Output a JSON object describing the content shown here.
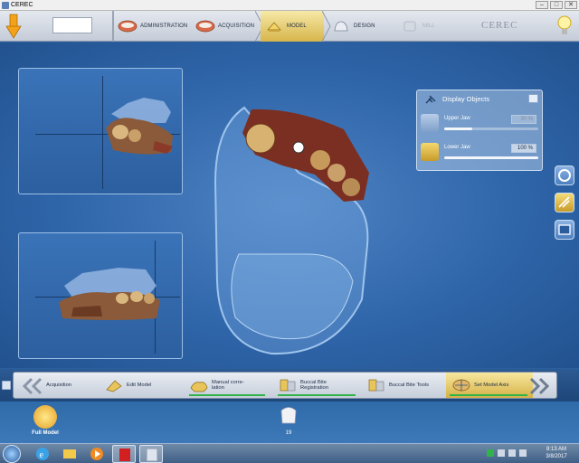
{
  "window": {
    "title": "CEREC",
    "controls": [
      "–",
      "□",
      "✕"
    ]
  },
  "topnav": {
    "steps": [
      {
        "label": "ADMINISTRATION",
        "icon": "administration-icon",
        "state": "normal"
      },
      {
        "label": "ACQUISITION",
        "icon": "acquisition-icon",
        "state": "normal"
      },
      {
        "label": "MODEL",
        "icon": "model-icon",
        "state": "active"
      },
      {
        "label": "DESIGN",
        "icon": "design-icon",
        "state": "normal"
      },
      {
        "label": "MILL",
        "icon": "mill-icon",
        "state": "disabled"
      }
    ],
    "logo": "CEREC"
  },
  "display_objects": {
    "title": "Display Objects",
    "rows": [
      {
        "label": "Upper Jaw",
        "value": "30 %",
        "level": 0.3,
        "icon": "upper-jaw-icon"
      },
      {
        "label": "Lower Jaw",
        "value": "100 %",
        "level": 1.0,
        "icon": "lower-jaw-icon"
      }
    ]
  },
  "side_buttons": [
    {
      "icon": "rotate-view-icon",
      "active": false
    },
    {
      "icon": "measure-tool-icon",
      "active": true
    },
    {
      "icon": "screenshot-icon",
      "active": false
    }
  ],
  "workflow": {
    "steps": [
      {
        "label": "Acquisition",
        "icon": "back-chevron-icon",
        "done": false,
        "active": false
      },
      {
        "label": "Edit Model",
        "icon": "edit-model-icon",
        "done": false,
        "active": false
      },
      {
        "label": "Manual corre-\nlation",
        "icon": "manual-correlation-icon",
        "done": true,
        "active": false
      },
      {
        "label": "Buccal Bite\nRegistration",
        "icon": "buccal-bite-registration-icon",
        "done": true,
        "active": false
      },
      {
        "label": "Buccal Bite Tools",
        "icon": "buccal-bite-tools-icon",
        "done": false,
        "active": false
      },
      {
        "label": "Set Model Axis",
        "icon": "set-model-axis-icon",
        "done": true,
        "active": true
      }
    ]
  },
  "modelbar": {
    "full_model_label": "Full Model",
    "tooth_label": "19"
  },
  "taskbar": {
    "apps": [
      "ie-icon",
      "explorer-icon",
      "media-player-icon",
      "pdf-reader-icon",
      "cerec-app-icon"
    ],
    "time": "8:13 AM",
    "date": "3/8/2017"
  },
  "colors": {
    "workspace": "#2f66aa",
    "active_step": "#d7b54a",
    "done_line": "#2fb34a"
  }
}
